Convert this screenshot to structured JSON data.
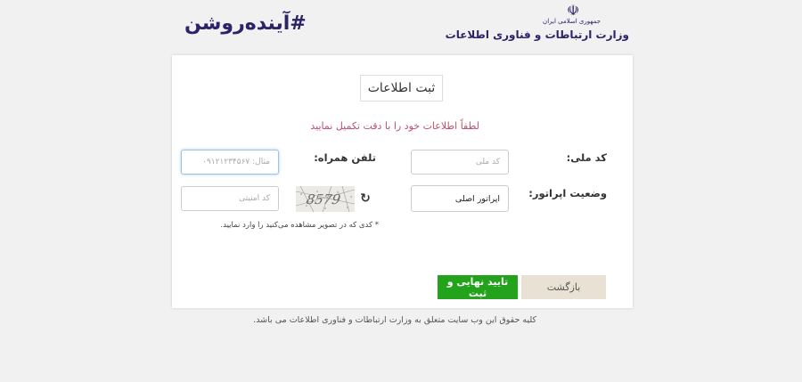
{
  "header": {
    "brand_text": "#آینده‌روشن",
    "ministry_small": "جمهوری اسلامی ایران",
    "ministry_name": "وزارت ارتباطات و فناوری اطلاعات"
  },
  "form": {
    "title": "ثبت اطلاعات",
    "subtitle": "لطفاً اطلاعات خود را با دقت تکمیل نمایید",
    "national_code_label": "کد ملی:",
    "national_code_placeholder": "کد ملی",
    "mobile_label": "تلفن همراه:",
    "mobile_placeholder": "مثال: ۰۹۱۲۱۲۳۴۵۶۷",
    "operator_status_label": "وضعیت اپراتور:",
    "operator_status_value": "اپراتور اصلی",
    "captcha_text": "8579",
    "security_code_placeholder": "کد امنیتی",
    "captcha_note": "* کدی که در تصویر مشاهده می‌کنید را وارد نمایید.",
    "confirm_button": "تایید نهایی و ثبت",
    "back_button": "بازگشت"
  },
  "footer": {
    "copyright": "کلیه حقوق این وب سایت متعلق به وزارت ارتباطات و فناوری اطلاعات می باشد."
  },
  "colors": {
    "confirm": "#23a31c",
    "back": "#e9e2d4",
    "subtitle": "#c0506b",
    "brand": "#2c2368"
  }
}
